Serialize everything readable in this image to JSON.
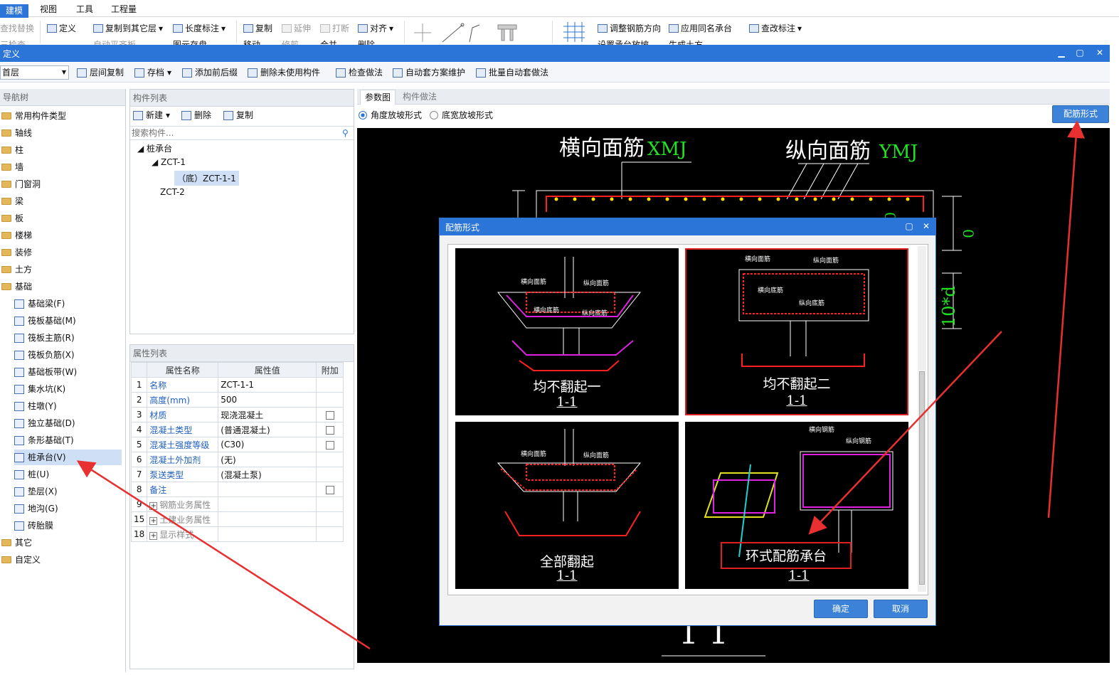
{
  "ribbon_tabs": [
    "建模",
    "视图",
    "工具",
    "工程量"
  ],
  "ribbon_buttons": {
    "find_replace": "查找替换",
    "define": "定义",
    "copy_to_floor": "复制到其它层",
    "length_dim": "长度标注",
    "copy": "复制",
    "extend": "延伸",
    "break": "打断",
    "align": "对齐",
    "adjust_rebar_dir": "调整钢筋方向",
    "apply_same_cap": "应用同名承台",
    "check_dim": "查改标注",
    "row2_a": "三检查",
    "row2_b": "自动平齐板",
    "row2_c": "图元存盘",
    "row2_d": "移动",
    "row2_e": "修剪",
    "row2_f": "合并",
    "row2_g": "删除",
    "row2_h": "设置承台放坡",
    "row2_i": "生成土方"
  },
  "definition_window": {
    "title": "定义",
    "floor": "首层",
    "toolbar": [
      "层间复制",
      "存档",
      "添加前后缀",
      "删除未使用构件",
      "检查做法",
      "自动套方案维护",
      "批量自动套做法"
    ]
  },
  "nav_tree": {
    "header": "导航树",
    "items": [
      "常用构件类型",
      "轴线",
      "柱",
      "墙",
      "门窗洞",
      "梁",
      "板",
      "楼梯",
      "装修",
      "土方",
      "基础"
    ],
    "foundation_children": [
      "基础梁(F)",
      "筏板基础(M)",
      "筏板主筋(R)",
      "筏板负筋(X)",
      "基础板带(W)",
      "集水坑(K)",
      "柱墩(Y)",
      "独立基础(D)",
      "条形基础(T)",
      "桩承台(V)",
      "桩(U)",
      "垫层(X)",
      "地沟(G)",
      "砖胎膜"
    ],
    "tail_items": [
      "其它",
      "自定义"
    ]
  },
  "component_list": {
    "header": "构件列表",
    "new": "新建",
    "delete": "删除",
    "copy": "复制",
    "search_placeholder": "搜索构件...",
    "tree": {
      "root": "桩承台",
      "child1": "ZCT-1",
      "child1_sub": "（底）ZCT-1-1",
      "child2": "ZCT-2"
    }
  },
  "property_list": {
    "header": "属性列表",
    "columns": [
      "属性名称",
      "属性值",
      "附加"
    ],
    "rows": [
      {
        "no": "1",
        "name": "名称",
        "value": "ZCT-1-1"
      },
      {
        "no": "2",
        "name": "高度(mm)",
        "value": "500"
      },
      {
        "no": "3",
        "name": "材质",
        "value": "现浇混凝土"
      },
      {
        "no": "4",
        "name": "混凝土类型",
        "value": "(普通混凝土)"
      },
      {
        "no": "5",
        "name": "混凝土强度等级",
        "value": "(C30)"
      },
      {
        "no": "6",
        "name": "混凝土外加剂",
        "value": "(无)"
      },
      {
        "no": "7",
        "name": "泵送类型",
        "value": "(混凝土泵)"
      },
      {
        "no": "8",
        "name": "备注",
        "value": ""
      },
      {
        "no": "9",
        "name": "钢筋业务属性",
        "value": ""
      },
      {
        "no": "15",
        "name": "土建业务属性",
        "value": ""
      },
      {
        "no": "18",
        "name": "显示样式",
        "value": ""
      }
    ]
  },
  "right_panel": {
    "tabs": [
      "参数图",
      "构件做法"
    ],
    "radio1": "角度放坡形式",
    "radio2": "底宽放坡形式",
    "rebar_form_button": "配筋形式",
    "cad_texts": {
      "top_left": "横向面筋",
      "top_left_code": "XMJ",
      "top_right": "纵向面筋",
      "top_right_code": "YMJ",
      "dim_zero": "0",
      "dim_10d": "10*d",
      "section": "1  1"
    }
  },
  "dialog": {
    "title": "配筋形式",
    "options": [
      {
        "label": "均不翻起一",
        "sub": "1-1"
      },
      {
        "label": "均不翻起二",
        "sub": "1-1"
      },
      {
        "label": "全部翻起",
        "sub": "1-1"
      },
      {
        "label": "环式配筋承台",
        "sub": "1-1"
      }
    ],
    "ok": "确定",
    "cancel": "取消"
  },
  "colors": {
    "accent": "#2b74d8",
    "highlight": "#e02020",
    "cad_green": "#22e022",
    "cad_red": "#ff2020",
    "cad_magenta": "#e020e0"
  }
}
